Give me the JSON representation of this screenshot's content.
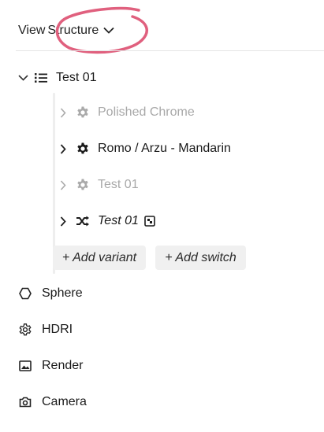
{
  "header": {
    "view_label": "View",
    "structure_label": "Structure",
    "dropdown_icon": "chevron-down-icon"
  },
  "tree": {
    "root": {
      "label": "Test 01",
      "icon": "list-icon",
      "expanded": true
    },
    "variants": [
      {
        "label": "Polished Chrome",
        "icon": "gear-icon",
        "state": "inactive"
      },
      {
        "label": "Romo / Arzu - Mandarin",
        "icon": "gear-icon",
        "state": "active"
      },
      {
        "label": "Test 01",
        "icon": "gear-icon",
        "state": "inactive"
      },
      {
        "label": "Test 01",
        "icon": "shuffle-icon",
        "state": "active",
        "italic": true,
        "badge_icon": "chip-icon"
      }
    ],
    "actions": {
      "add_variant": "+ Add variant",
      "add_switch": "+ Add switch"
    }
  },
  "objects": [
    {
      "label": "Sphere",
      "icon": "hexagon-icon"
    },
    {
      "label": "HDRI",
      "icon": "cog-icon"
    },
    {
      "label": "Render",
      "icon": "image-icon"
    },
    {
      "label": "Camera",
      "icon": "camera-icon"
    }
  ],
  "colors": {
    "highlight": "#e0607e",
    "muted": "#a8a8a8",
    "text": "#222222",
    "pill_bg": "#f0f0f0"
  }
}
